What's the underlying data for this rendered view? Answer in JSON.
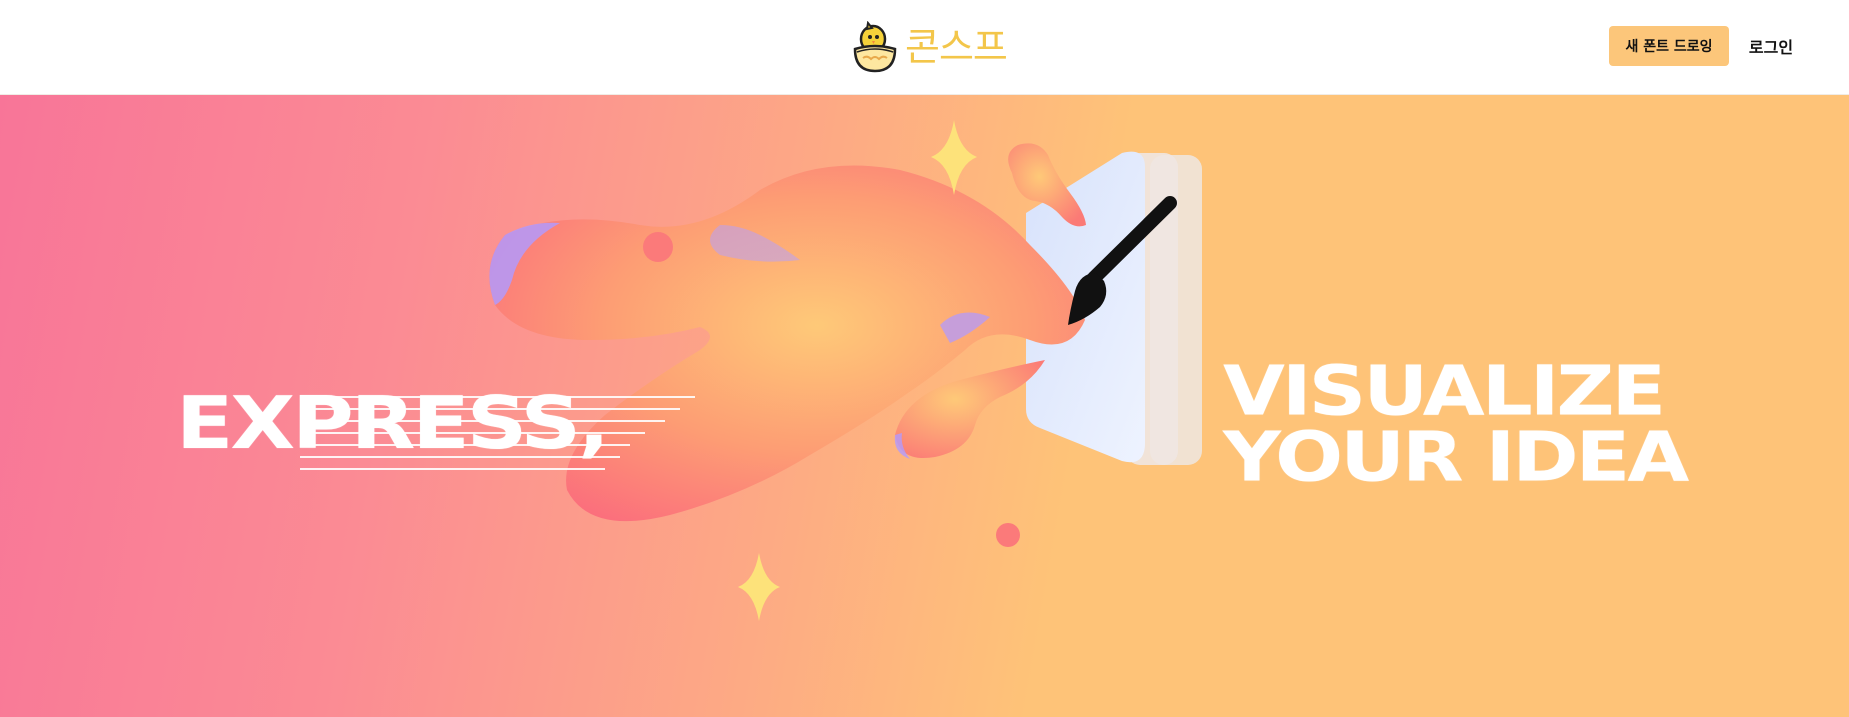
{
  "header": {
    "logo_text": "콘스프",
    "new_font_button": "새 폰트 드로잉",
    "login_button": "로그인"
  },
  "hero": {
    "left_text": "EXPRESS,",
    "right_line_1": "VISUALIZE",
    "right_line_2": "YOUR IDEA"
  },
  "colors": {
    "brand_yellow": "#f3c64a",
    "button_bg": "#fcc67a",
    "hero_pink": "#f87598",
    "hero_orange": "#fec378",
    "text_dark": "#111111"
  },
  "icons": {
    "logo": "chick-in-bowl-icon",
    "brush": "paint-brush-icon",
    "sparkle": "sparkle-icon"
  }
}
